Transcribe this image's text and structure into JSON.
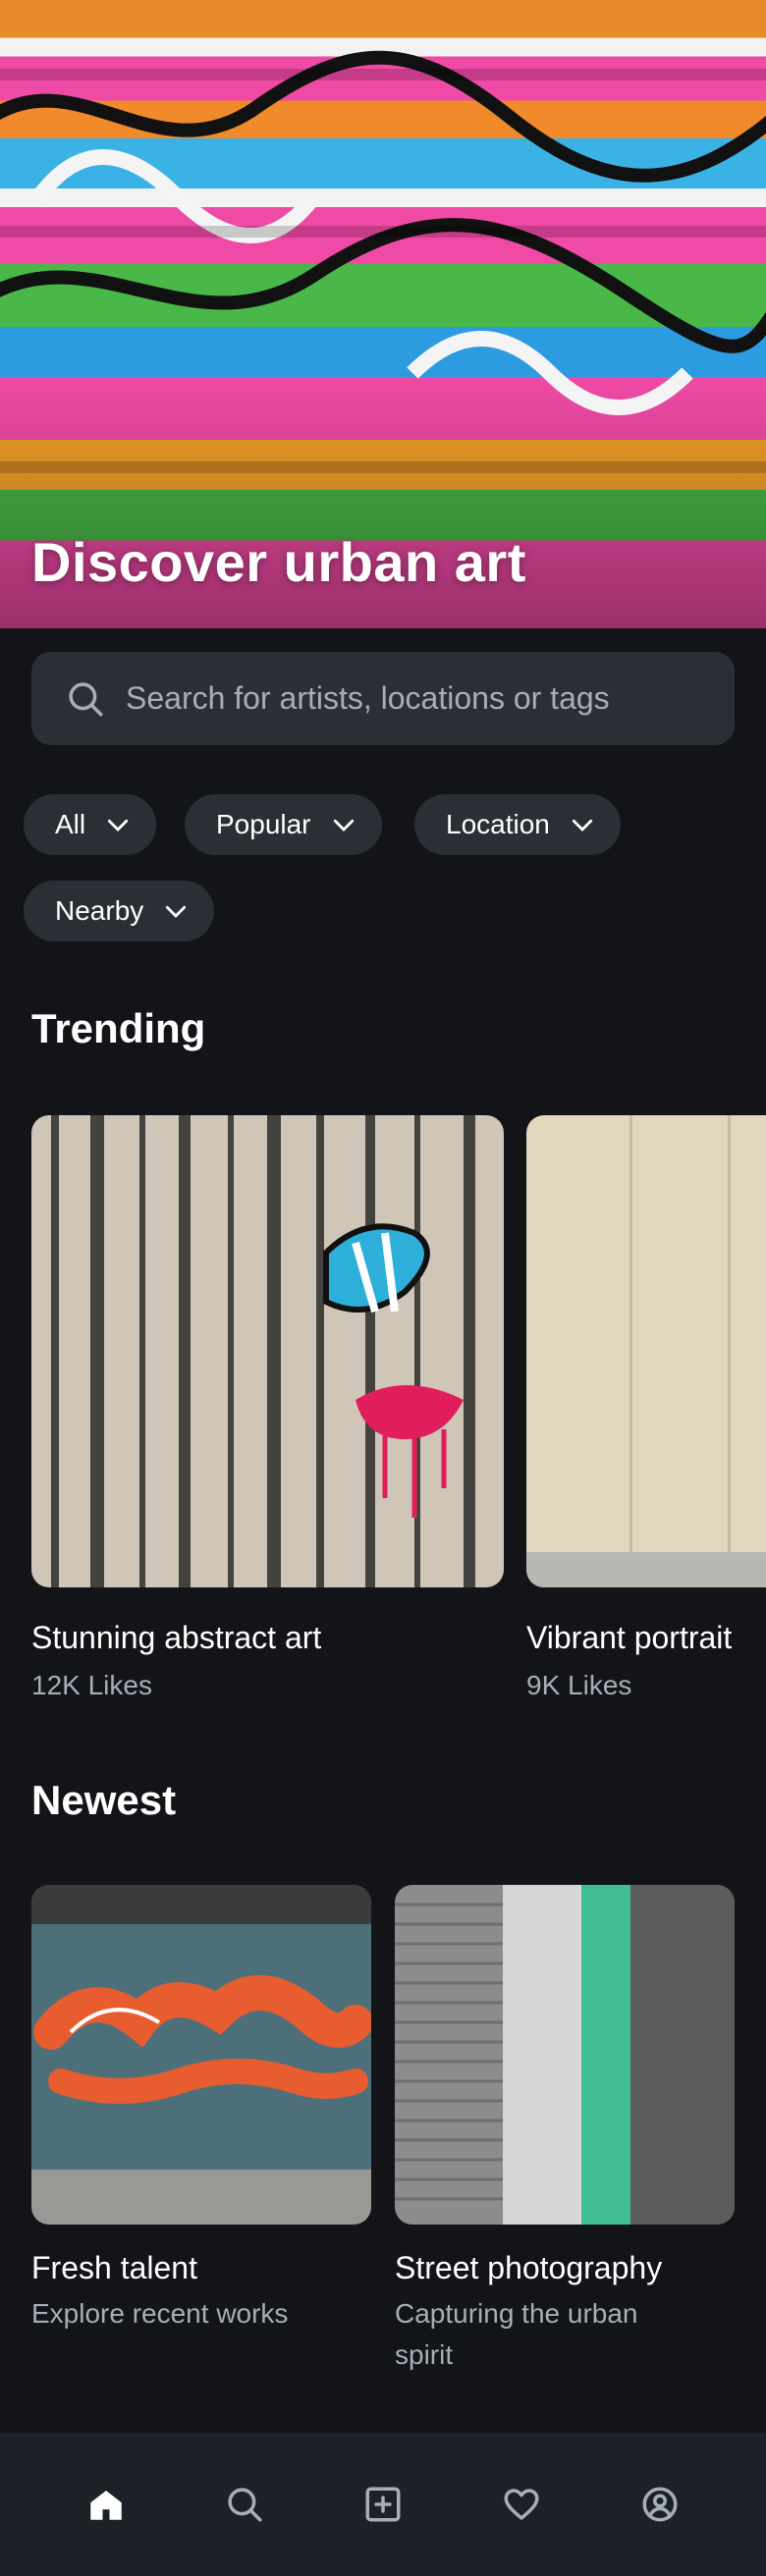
{
  "hero": {
    "title": "Discover urban art",
    "image_icon": "graffiti-wall-image"
  },
  "search": {
    "placeholder": "Search for artists, locations or tags",
    "icon": "search-icon"
  },
  "filters": [
    {
      "label": "All",
      "icon": "chevron-down-icon"
    },
    {
      "label": "Popular",
      "icon": "chevron-down-icon"
    },
    {
      "label": "Location",
      "icon": "chevron-down-icon"
    },
    {
      "label": "Nearby",
      "icon": "chevron-down-icon"
    }
  ],
  "trending": {
    "title": "Trending",
    "items": [
      {
        "title": "Stunning abstract art",
        "likes": "12K Likes"
      },
      {
        "title": "Vibrant portrait",
        "likes": "9K Likes"
      }
    ]
  },
  "newest": {
    "title": "Newest",
    "items": [
      {
        "title": "Fresh talent",
        "subtitle": "Explore recent works"
      },
      {
        "title": "Street photography",
        "subtitle_line1": "Capturing the urban",
        "subtitle_line2": "spirit"
      }
    ]
  },
  "nav": {
    "items": [
      "home-icon",
      "search-icon",
      "add-icon",
      "heart-icon",
      "profile-icon"
    ],
    "active": "home-icon"
  },
  "colors": {
    "background": "#121418",
    "surface": "#2a2f36",
    "nav_background": "#1c2027",
    "muted_text": "#a7aeb8"
  }
}
